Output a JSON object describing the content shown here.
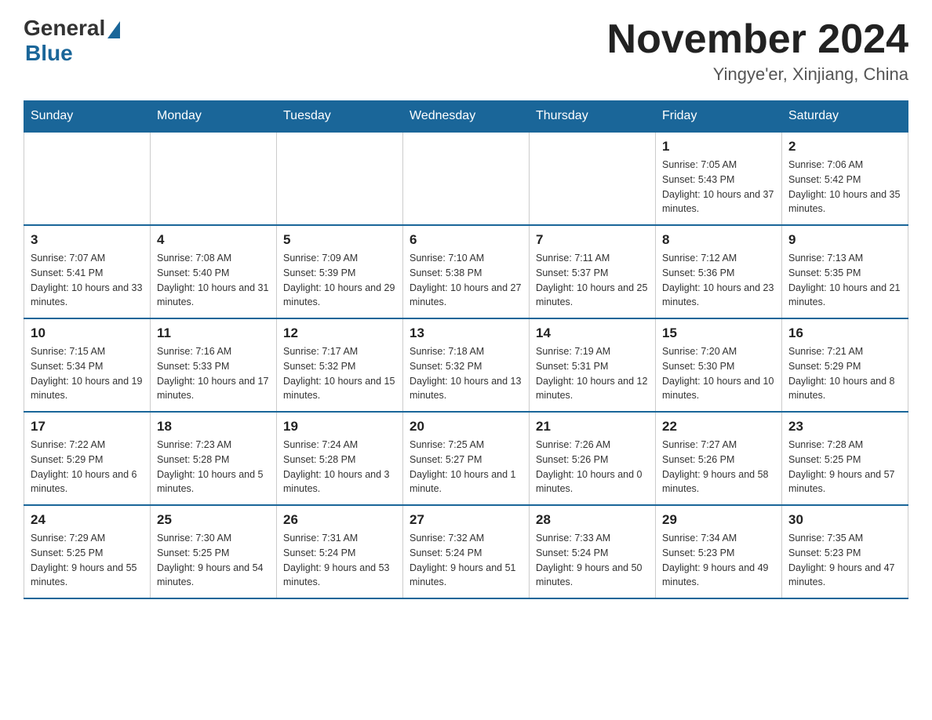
{
  "header": {
    "logo_general": "General",
    "logo_blue": "Blue",
    "month_title": "November 2024",
    "location": "Yingye'er, Xinjiang, China"
  },
  "weekdays": [
    "Sunday",
    "Monday",
    "Tuesday",
    "Wednesday",
    "Thursday",
    "Friday",
    "Saturday"
  ],
  "weeks": [
    [
      {
        "day": "",
        "sunrise": "",
        "sunset": "",
        "daylight": ""
      },
      {
        "day": "",
        "sunrise": "",
        "sunset": "",
        "daylight": ""
      },
      {
        "day": "",
        "sunrise": "",
        "sunset": "",
        "daylight": ""
      },
      {
        "day": "",
        "sunrise": "",
        "sunset": "",
        "daylight": ""
      },
      {
        "day": "",
        "sunrise": "",
        "sunset": "",
        "daylight": ""
      },
      {
        "day": "1",
        "sunrise": "Sunrise: 7:05 AM",
        "sunset": "Sunset: 5:43 PM",
        "daylight": "Daylight: 10 hours and 37 minutes."
      },
      {
        "day": "2",
        "sunrise": "Sunrise: 7:06 AM",
        "sunset": "Sunset: 5:42 PM",
        "daylight": "Daylight: 10 hours and 35 minutes."
      }
    ],
    [
      {
        "day": "3",
        "sunrise": "Sunrise: 7:07 AM",
        "sunset": "Sunset: 5:41 PM",
        "daylight": "Daylight: 10 hours and 33 minutes."
      },
      {
        "day": "4",
        "sunrise": "Sunrise: 7:08 AM",
        "sunset": "Sunset: 5:40 PM",
        "daylight": "Daylight: 10 hours and 31 minutes."
      },
      {
        "day": "5",
        "sunrise": "Sunrise: 7:09 AM",
        "sunset": "Sunset: 5:39 PM",
        "daylight": "Daylight: 10 hours and 29 minutes."
      },
      {
        "day": "6",
        "sunrise": "Sunrise: 7:10 AM",
        "sunset": "Sunset: 5:38 PM",
        "daylight": "Daylight: 10 hours and 27 minutes."
      },
      {
        "day": "7",
        "sunrise": "Sunrise: 7:11 AM",
        "sunset": "Sunset: 5:37 PM",
        "daylight": "Daylight: 10 hours and 25 minutes."
      },
      {
        "day": "8",
        "sunrise": "Sunrise: 7:12 AM",
        "sunset": "Sunset: 5:36 PM",
        "daylight": "Daylight: 10 hours and 23 minutes."
      },
      {
        "day": "9",
        "sunrise": "Sunrise: 7:13 AM",
        "sunset": "Sunset: 5:35 PM",
        "daylight": "Daylight: 10 hours and 21 minutes."
      }
    ],
    [
      {
        "day": "10",
        "sunrise": "Sunrise: 7:15 AM",
        "sunset": "Sunset: 5:34 PM",
        "daylight": "Daylight: 10 hours and 19 minutes."
      },
      {
        "day": "11",
        "sunrise": "Sunrise: 7:16 AM",
        "sunset": "Sunset: 5:33 PM",
        "daylight": "Daylight: 10 hours and 17 minutes."
      },
      {
        "day": "12",
        "sunrise": "Sunrise: 7:17 AM",
        "sunset": "Sunset: 5:32 PM",
        "daylight": "Daylight: 10 hours and 15 minutes."
      },
      {
        "day": "13",
        "sunrise": "Sunrise: 7:18 AM",
        "sunset": "Sunset: 5:32 PM",
        "daylight": "Daylight: 10 hours and 13 minutes."
      },
      {
        "day": "14",
        "sunrise": "Sunrise: 7:19 AM",
        "sunset": "Sunset: 5:31 PM",
        "daylight": "Daylight: 10 hours and 12 minutes."
      },
      {
        "day": "15",
        "sunrise": "Sunrise: 7:20 AM",
        "sunset": "Sunset: 5:30 PM",
        "daylight": "Daylight: 10 hours and 10 minutes."
      },
      {
        "day": "16",
        "sunrise": "Sunrise: 7:21 AM",
        "sunset": "Sunset: 5:29 PM",
        "daylight": "Daylight: 10 hours and 8 minutes."
      }
    ],
    [
      {
        "day": "17",
        "sunrise": "Sunrise: 7:22 AM",
        "sunset": "Sunset: 5:29 PM",
        "daylight": "Daylight: 10 hours and 6 minutes."
      },
      {
        "day": "18",
        "sunrise": "Sunrise: 7:23 AM",
        "sunset": "Sunset: 5:28 PM",
        "daylight": "Daylight: 10 hours and 5 minutes."
      },
      {
        "day": "19",
        "sunrise": "Sunrise: 7:24 AM",
        "sunset": "Sunset: 5:28 PM",
        "daylight": "Daylight: 10 hours and 3 minutes."
      },
      {
        "day": "20",
        "sunrise": "Sunrise: 7:25 AM",
        "sunset": "Sunset: 5:27 PM",
        "daylight": "Daylight: 10 hours and 1 minute."
      },
      {
        "day": "21",
        "sunrise": "Sunrise: 7:26 AM",
        "sunset": "Sunset: 5:26 PM",
        "daylight": "Daylight: 10 hours and 0 minutes."
      },
      {
        "day": "22",
        "sunrise": "Sunrise: 7:27 AM",
        "sunset": "Sunset: 5:26 PM",
        "daylight": "Daylight: 9 hours and 58 minutes."
      },
      {
        "day": "23",
        "sunrise": "Sunrise: 7:28 AM",
        "sunset": "Sunset: 5:25 PM",
        "daylight": "Daylight: 9 hours and 57 minutes."
      }
    ],
    [
      {
        "day": "24",
        "sunrise": "Sunrise: 7:29 AM",
        "sunset": "Sunset: 5:25 PM",
        "daylight": "Daylight: 9 hours and 55 minutes."
      },
      {
        "day": "25",
        "sunrise": "Sunrise: 7:30 AM",
        "sunset": "Sunset: 5:25 PM",
        "daylight": "Daylight: 9 hours and 54 minutes."
      },
      {
        "day": "26",
        "sunrise": "Sunrise: 7:31 AM",
        "sunset": "Sunset: 5:24 PM",
        "daylight": "Daylight: 9 hours and 53 minutes."
      },
      {
        "day": "27",
        "sunrise": "Sunrise: 7:32 AM",
        "sunset": "Sunset: 5:24 PM",
        "daylight": "Daylight: 9 hours and 51 minutes."
      },
      {
        "day": "28",
        "sunrise": "Sunrise: 7:33 AM",
        "sunset": "Sunset: 5:24 PM",
        "daylight": "Daylight: 9 hours and 50 minutes."
      },
      {
        "day": "29",
        "sunrise": "Sunrise: 7:34 AM",
        "sunset": "Sunset: 5:23 PM",
        "daylight": "Daylight: 9 hours and 49 minutes."
      },
      {
        "day": "30",
        "sunrise": "Sunrise: 7:35 AM",
        "sunset": "Sunset: 5:23 PM",
        "daylight": "Daylight: 9 hours and 47 minutes."
      }
    ]
  ]
}
